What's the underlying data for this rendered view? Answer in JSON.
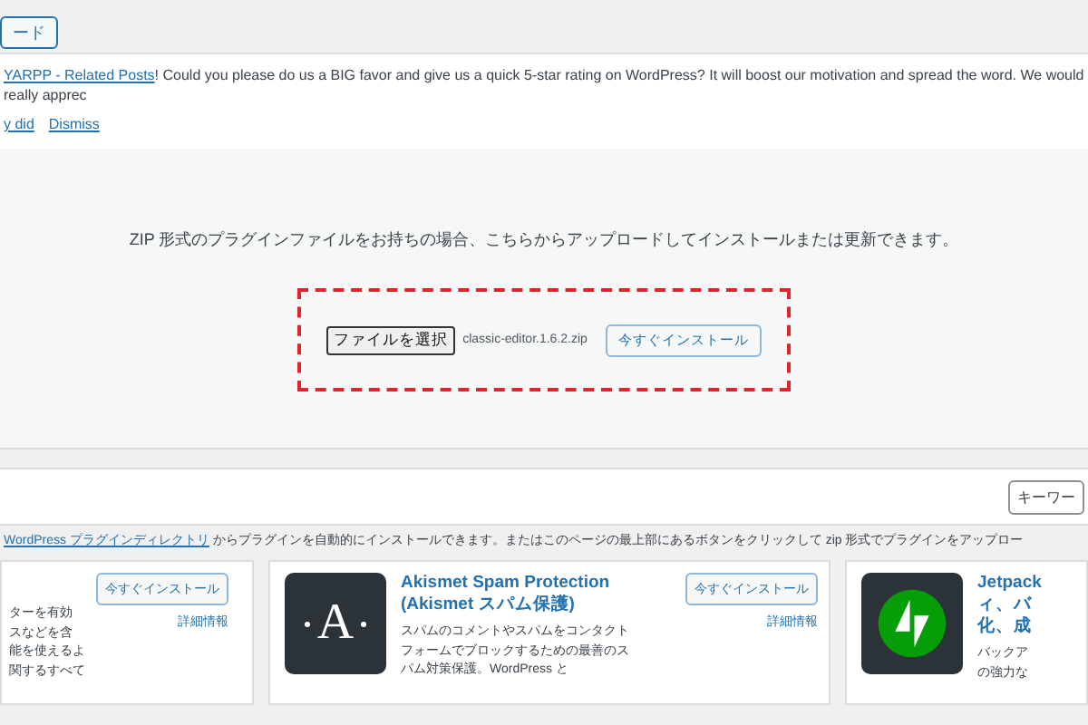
{
  "top_button": {
    "label": "ード"
  },
  "notice": {
    "link": "YARPP - Related Posts",
    "text": "! Could you please do us a BIG favor and give us a quick 5-star rating on WordPress? It will boost our motivation and spread the word. We would really apprec",
    "actions": [
      "y did",
      "Dismiss"
    ]
  },
  "upload": {
    "message": "ZIP 形式のプラグインファイルをお持ちの場合、こちらからアップロードしてインストールまたは更新できます。",
    "choose_button": "ファイルを選択",
    "file_name": "classic-editor.1.6.2.zip",
    "install_button": "今すぐインストール"
  },
  "filter": {
    "keyword_select": "キーワー"
  },
  "description": {
    "link": "WordPress プラグインディレクトリ",
    "text": " からプラグインを自動的にインストールできます。またはこのページの最上部にあるボタンをクリックして zip 形式でプラグインをアップロー"
  },
  "cards": [
    {
      "kind": "partial",
      "description_lines": [
        "ターを有効",
        "スなどを含",
        "能を使えるよ",
        "関するすべて"
      ],
      "install_button": "今すぐインストール",
      "details_link": "詳細情報"
    },
    {
      "kind": "akismet",
      "logo_text": "A",
      "title_lines": [
        "Akismet Spam Protection",
        "(Akismet スパム保護)"
      ],
      "description_lines": [
        "スパムのコメントやスパムをコンタクト",
        "フォームでブロックするための最善のス",
        "パム対策保護。WordPress と"
      ],
      "install_button": "今すぐインストール",
      "details_link": "詳細情報"
    },
    {
      "kind": "jetpack",
      "title_lines": [
        "Jetpack",
        "ィ、バ",
        "化、成"
      ],
      "description_lines": [
        "バックア",
        "の強力な"
      ]
    }
  ]
}
